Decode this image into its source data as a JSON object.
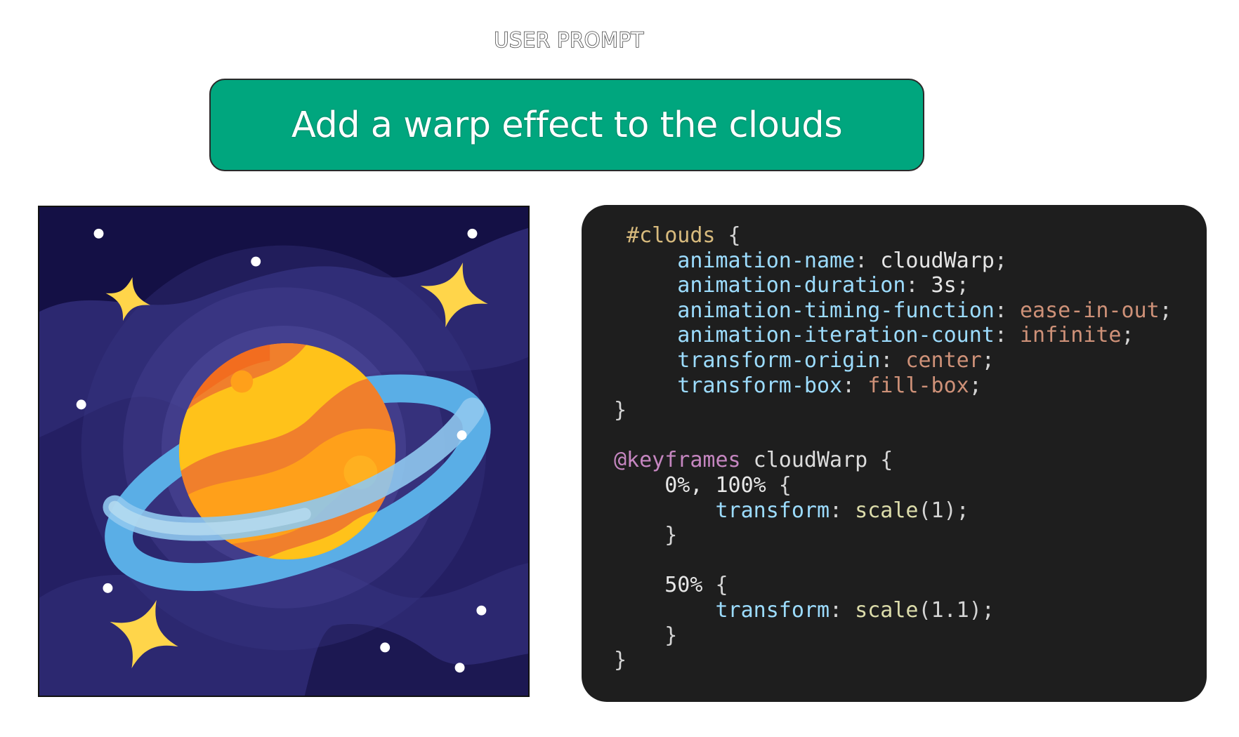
{
  "header": {
    "label": "USER PROMPT"
  },
  "prompt": {
    "text": "Add a warp effect to the clouds"
  },
  "illustration": {
    "name": "planet-illustration",
    "colors": {
      "sky": "#141045",
      "cloud": "#2c2870",
      "halo": "#3a3685",
      "planet": "#f07f2c",
      "planet_band": "#ffc21a",
      "ring": "#5aaee6",
      "star": "#ffd54a",
      "dot": "#ffffff"
    }
  },
  "code": {
    "lines": [
      [
        {
          "t": " #clouds",
          "c": "sel"
        },
        {
          "t": " {",
          "c": "punct"
        }
      ],
      [
        {
          "t": "     animation-name",
          "c": "prop"
        },
        {
          "t": ": ",
          "c": "punct"
        },
        {
          "t": "cloudWarp",
          "c": "val"
        },
        {
          "t": ";",
          "c": "punct"
        }
      ],
      [
        {
          "t": "     animation-duration",
          "c": "prop"
        },
        {
          "t": ": ",
          "c": "punct"
        },
        {
          "t": "3s",
          "c": "val"
        },
        {
          "t": ";",
          "c": "punct"
        }
      ],
      [
        {
          "t": "     animation-timing-function",
          "c": "prop"
        },
        {
          "t": ": ",
          "c": "punct"
        },
        {
          "t": "ease-in-out",
          "c": "kw"
        },
        {
          "t": ";",
          "c": "punct"
        }
      ],
      [
        {
          "t": "     animation-iteration-count",
          "c": "prop"
        },
        {
          "t": ": ",
          "c": "punct"
        },
        {
          "t": "infinite",
          "c": "kw"
        },
        {
          "t": ";",
          "c": "punct"
        }
      ],
      [
        {
          "t": "     transform-origin",
          "c": "prop"
        },
        {
          "t": ": ",
          "c": "punct"
        },
        {
          "t": "center",
          "c": "kw"
        },
        {
          "t": ";",
          "c": "punct"
        }
      ],
      [
        {
          "t": "     transform-box",
          "c": "prop"
        },
        {
          "t": ": ",
          "c": "punct"
        },
        {
          "t": "fill-box",
          "c": "kw"
        },
        {
          "t": ";",
          "c": "punct"
        }
      ],
      [
        {
          "t": "}",
          "c": "punct"
        }
      ],
      [
        {
          "t": "",
          "c": "punct"
        }
      ],
      [
        {
          "t": "@keyframes",
          "c": "at"
        },
        {
          "t": " cloudWarp",
          "c": "name"
        },
        {
          "t": " {",
          "c": "punct"
        }
      ],
      [
        {
          "t": "    0%, 100%",
          "c": "num"
        },
        {
          "t": " {",
          "c": "punct"
        }
      ],
      [
        {
          "t": "        transform",
          "c": "prop"
        },
        {
          "t": ": ",
          "c": "punct"
        },
        {
          "t": "scale",
          "c": "fn"
        },
        {
          "t": "(1);",
          "c": "punct"
        }
      ],
      [
        {
          "t": "    }",
          "c": "punct"
        }
      ],
      [
        {
          "t": "",
          "c": "punct"
        }
      ],
      [
        {
          "t": "    50%",
          "c": "num"
        },
        {
          "t": " {",
          "c": "punct"
        }
      ],
      [
        {
          "t": "        transform",
          "c": "prop"
        },
        {
          "t": ": ",
          "c": "punct"
        },
        {
          "t": "scale",
          "c": "fn"
        },
        {
          "t": "(1.1);",
          "c": "punct"
        }
      ],
      [
        {
          "t": "    }",
          "c": "punct"
        }
      ],
      [
        {
          "t": "}",
          "c": "punct"
        }
      ]
    ]
  }
}
